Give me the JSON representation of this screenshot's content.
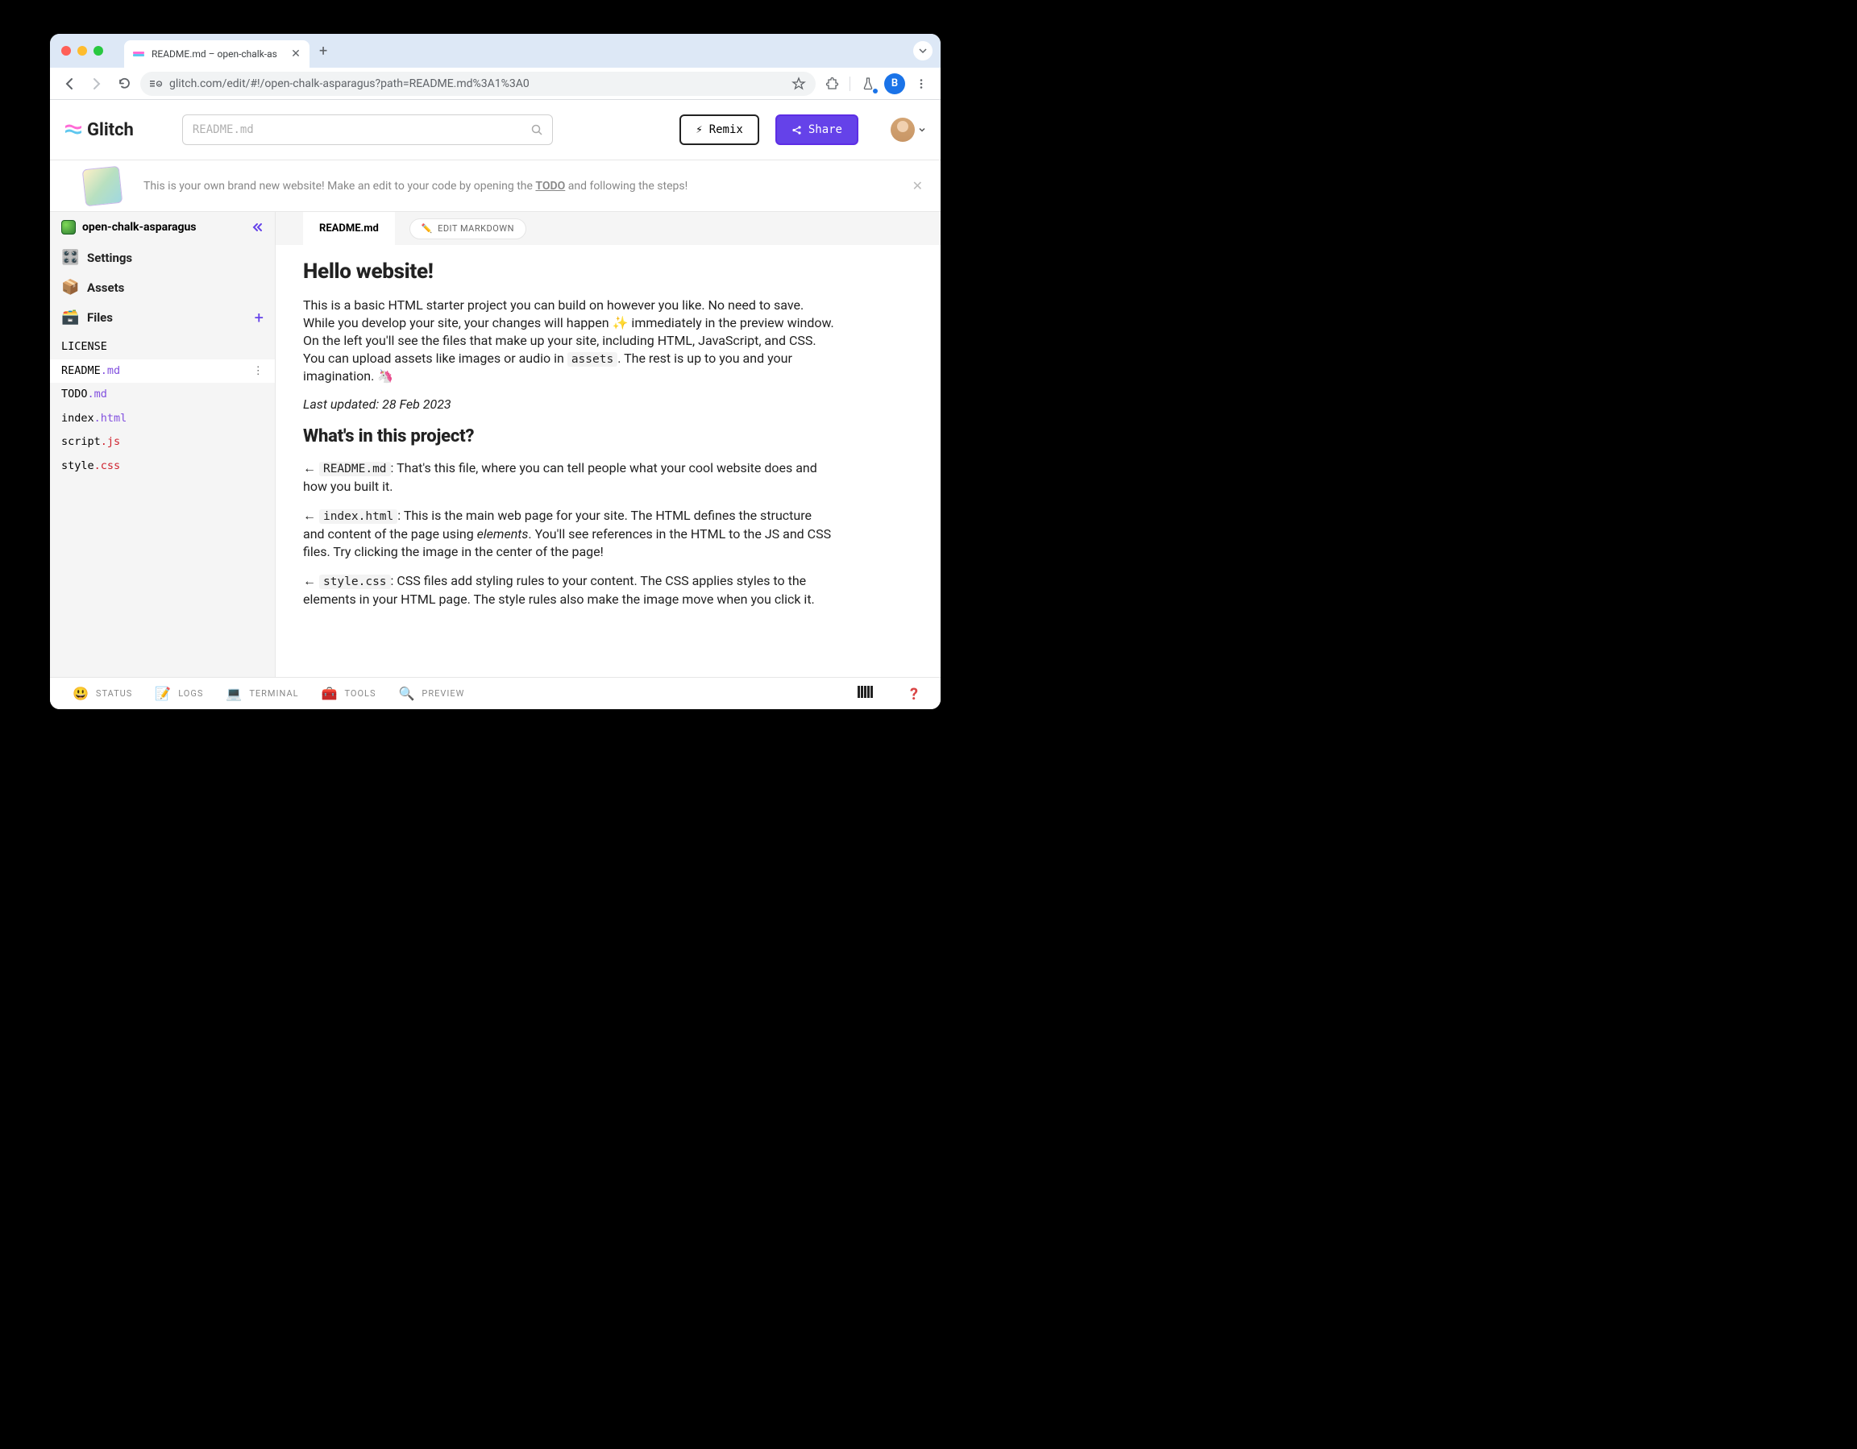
{
  "browser": {
    "tab_title": "README.md – open-chalk-as",
    "url": "glitch.com/edit/#!/open-chalk-asparagus?path=README.md%3A1%3A0",
    "profile_letter": "B"
  },
  "header": {
    "logo_text": "Glitch",
    "search_placeholder": "README.md",
    "remix_label": "Remix",
    "share_label": "Share"
  },
  "banner": {
    "text_pre": "This is your own brand new website! Make an edit to your code by opening the ",
    "todo_label": "TODO",
    "text_post": " and following the steps!"
  },
  "sidebar": {
    "project_name": "open-chalk-asparagus",
    "settings_label": "Settings",
    "assets_label": "Assets",
    "files_label": "Files",
    "files": [
      {
        "name": "LICENSE",
        "ext": ""
      },
      {
        "name": "README",
        "ext": ".md",
        "active": true
      },
      {
        "name": "TODO",
        "ext": ".md"
      },
      {
        "name": "index",
        "ext": ".html"
      },
      {
        "name": "script",
        "ext": ".js"
      },
      {
        "name": "style",
        "ext": ".css"
      }
    ]
  },
  "editor": {
    "tab_name": "README.md",
    "edit_markdown_label": "EDIT MARKDOWN",
    "h1": "Hello website!",
    "intro_p1": "This is a basic HTML starter project you can build on however you like. No need to save. While you develop your site, your changes will happen ✨ immediately in the preview window. On the left you'll see the files that make up your site, including HTML, JavaScript, and CSS. You can upload assets like images or audio in ",
    "intro_code": "assets",
    "intro_p2": ". The rest is up to you and your imagination. 🦄",
    "updated": "Last updated: 28 Feb 2023",
    "h2": "What's in this project?",
    "items": [
      {
        "arrow": "←",
        "code": "README.md",
        "text": ": That's this file, where you can tell people what your cool website does and how you built it."
      },
      {
        "arrow": "←",
        "code": "index.html",
        "text_pre": ": This is the main web page for your site. The HTML defines the structure and content of the page using ",
        "em": "elements",
        "text_post": ". You'll see references in the HTML to the JS and CSS files. Try clicking the image in the center of the page!"
      },
      {
        "arrow": "←",
        "code": "style.css",
        "text": ": CSS files add styling rules to your content. The CSS applies styles to the elements in your HTML page. The style rules also make the image move when you click it."
      }
    ]
  },
  "footer": {
    "status": "STATUS",
    "logs": "LOGS",
    "terminal": "TERMINAL",
    "tools": "TOOLS",
    "preview": "PREVIEW"
  }
}
